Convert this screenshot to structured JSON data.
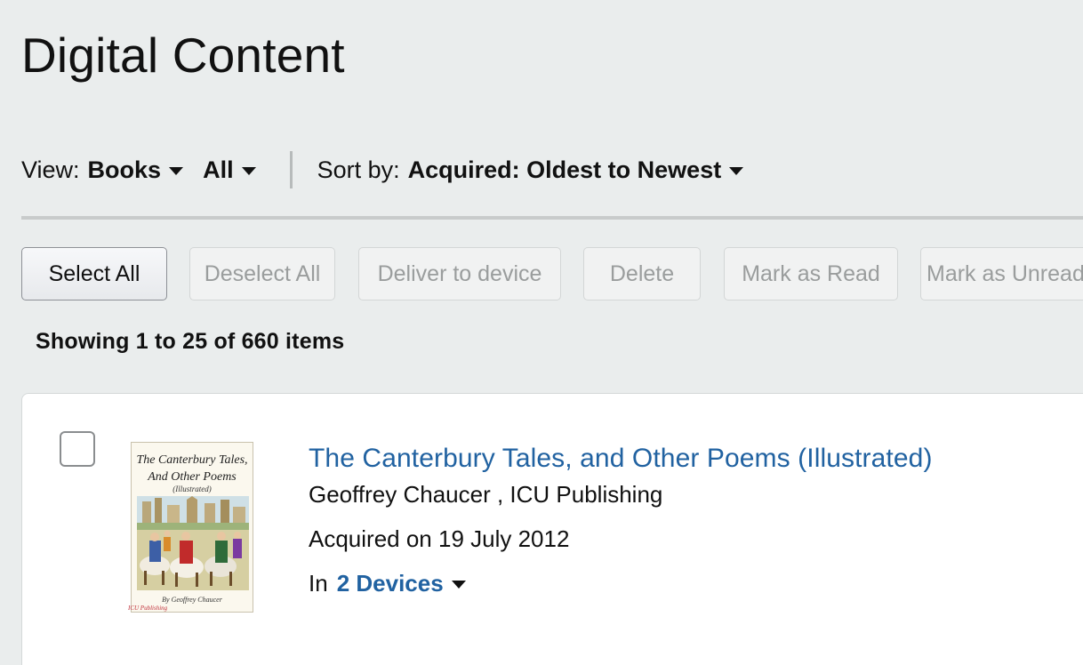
{
  "page_title": "Digital Content",
  "filters": {
    "view_label": "View:",
    "view_value": "Books",
    "subview_value": "All",
    "sort_label": "Sort by:",
    "sort_value": "Acquired: Oldest to Newest"
  },
  "actions": {
    "select_all": "Select All",
    "deselect_all": "Deselect All",
    "deliver_to_device": "Deliver to device",
    "delete": "Delete",
    "mark_as_read": "Mark as Read",
    "mark_as_unread": "Mark as Unread"
  },
  "showing_text": "Showing 1 to 25 of 660 items",
  "items": [
    {
      "title": "The Canterbury Tales, and Other Poems (Illustrated)",
      "authors": "Geoffrey Chaucer , ICU Publishing",
      "acquired": "Acquired on 19 July 2012",
      "in_label": "In",
      "devices_link": "2 Devices",
      "cover": {
        "title_line1": "The Canterbury Tales,",
        "title_line2": "And Other Poems",
        "subtitle": "(Illustrated)",
        "author": "By Geoffrey Chaucer",
        "publisher_mark": "ICU Publishing"
      }
    }
  ],
  "colors": {
    "background": "#eaeded",
    "link": "#2162a1",
    "card": "#ffffff"
  }
}
